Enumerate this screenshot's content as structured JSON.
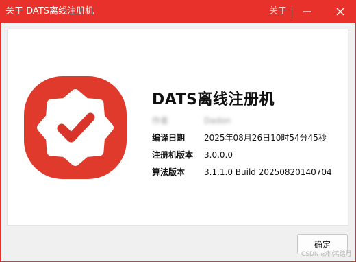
{
  "window": {
    "title": "关于 DATS离线注册机",
    "about_label": "关于"
  },
  "app": {
    "name": "DATS离线注册机"
  },
  "info": [
    {
      "label": "作者",
      "value": "Dadon"
    },
    {
      "label": "编译日期",
      "value": "2025年08月26日10时54分45秒"
    },
    {
      "label": "注册机版本",
      "value": "3.0.0.0"
    },
    {
      "label": "算法版本",
      "value": "3.1.1.0 Build 20250820140704"
    }
  ],
  "buttons": {
    "ok_label": "确定"
  },
  "watermark": "CSDN @钟鸿踏月",
  "colors": {
    "titlebar": "#e9312c",
    "logo_background": "#e03a2c",
    "dialog_background": "#f0f0f0"
  },
  "icons": {
    "logo": "verified-badge-check-icon",
    "minimize": "minimize-icon",
    "close": "close-icon"
  }
}
